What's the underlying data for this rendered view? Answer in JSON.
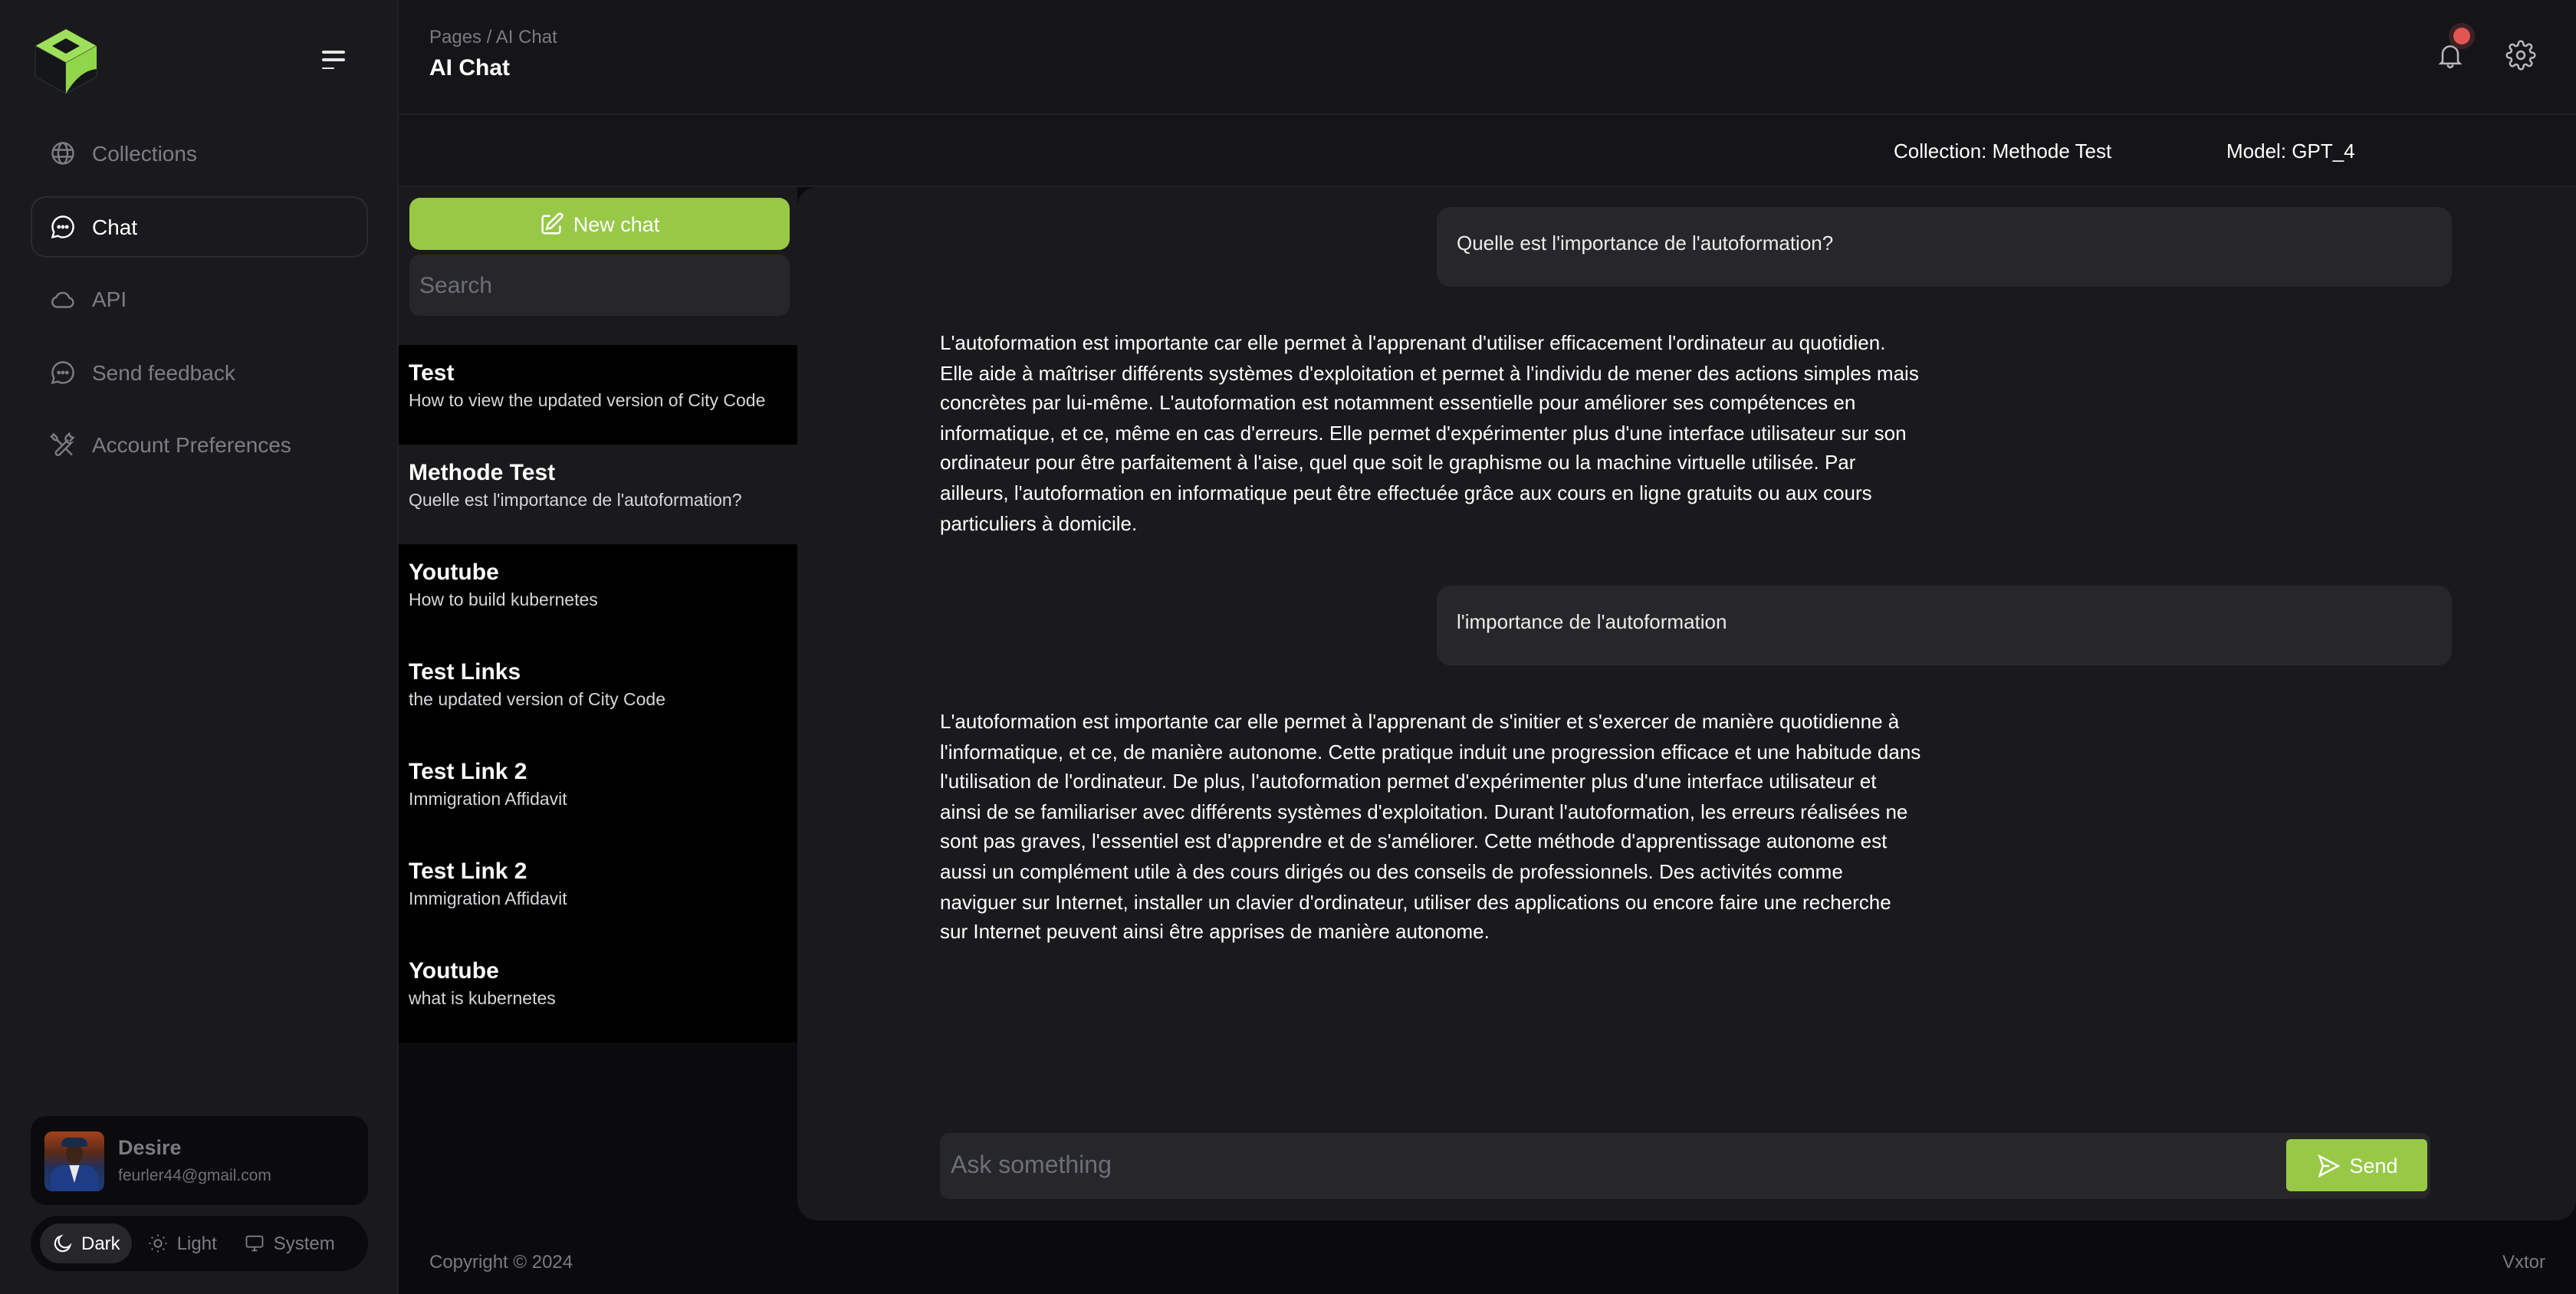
{
  "sidebar": {
    "brand_color": "#97c947",
    "nav": [
      {
        "label": "Collections",
        "icon": "globe-icon",
        "active": false
      },
      {
        "label": "Chat",
        "icon": "chat-bubble-icon",
        "active": true
      },
      {
        "label": "API",
        "icon": "cloud-icon",
        "active": false
      },
      {
        "label": "Send feedback",
        "icon": "chat-bubble-icon",
        "active": false
      },
      {
        "label": "Account Preferences",
        "icon": "tools-icon",
        "active": false
      }
    ],
    "user": {
      "name": "Desire",
      "email": "feurler44@gmail.com"
    },
    "theme": {
      "options": [
        {
          "label": "Dark",
          "icon": "moon-icon"
        },
        {
          "label": "Light",
          "icon": "sun-icon"
        },
        {
          "label": "System",
          "icon": "monitor-icon"
        }
      ],
      "selected": "Dark"
    }
  },
  "header": {
    "breadcrumb": "Pages / AI Chat",
    "title": "AI Chat",
    "notification_dot_color": "#e25550"
  },
  "subheader": {
    "collection": "Collection: Methode Test",
    "model": "Model: GPT_4"
  },
  "chatlist": {
    "new_chat_label": "New chat",
    "search_placeholder": "Search",
    "items": [
      {
        "title": "Test",
        "subtitle": "How to view the updated version of City Code",
        "active": false
      },
      {
        "title": "Methode Test",
        "subtitle": "Quelle est l'importance de l'autoformation?",
        "active": true
      },
      {
        "title": "Youtube",
        "subtitle": "How to build kubernetes",
        "active": false
      },
      {
        "title": "Test Links",
        "subtitle": "the updated version of City Code",
        "active": false
      },
      {
        "title": "Test Link 2",
        "subtitle": "Immigration Affidavit",
        "active": false
      },
      {
        "title": "Test Link 2",
        "subtitle": "Immigration Affidavit",
        "active": false
      },
      {
        "title": "Youtube",
        "subtitle": "what is kubernetes",
        "active": false
      }
    ]
  },
  "conversation": {
    "messages": [
      {
        "role": "user",
        "text": "Quelle est l'importance de l'autoformation?"
      },
      {
        "role": "assistant",
        "text": "L'autoformation est importante car elle permet à l'apprenant d'utiliser efficacement l'ordinateur au quotidien. Elle aide à maîtriser différents systèmes d'exploitation et permet à l'individu de mener des actions simples mais concrètes par lui-même. L'autoformation est notamment essentielle pour améliorer ses compétences en informatique, et ce, même en cas d'erreurs. Elle permet d'expérimenter plus d'une interface utilisateur sur son ordinateur pour être parfaitement à l'aise, quel que soit le graphisme ou la machine virtuelle utilisée. Par ailleurs, l'autoformation en informatique peut être effectuée grâce aux cours en ligne gratuits ou aux cours particuliers à domicile."
      },
      {
        "role": "user",
        "text": "l'importance de l'autoformation"
      },
      {
        "role": "assistant",
        "text": "L'autoformation est importante car elle permet à l'apprenant de s'initier et s'exercer de manière quotidienne à l'informatique, et ce, de manière autonome. Cette pratique induit une progression efficace et une habitude dans l'utilisation de l'ordinateur. De plus, l'autoformation permet d'expérimenter plus d'une interface utilisateur et ainsi de se familiariser avec différents systèmes d'exploitation. Durant l'autoformation, les erreurs réalisées ne sont pas graves, l'essentiel est d'apprendre et de s'améliorer. Cette méthode d'apprentissage autonome est aussi un complément utile à des cours dirigés ou des conseils de professionnels. Des activités comme naviguer sur Internet, installer un clavier d'ordinateur, utiliser des applications ou encore faire une recherche sur Internet peuvent ainsi être apprises de manière autonome."
      }
    ],
    "input_placeholder": "Ask something",
    "input_value": "",
    "send_label": "Send"
  },
  "footer": {
    "copyright": "Copyright © 2024",
    "brand": "Vxtor"
  }
}
